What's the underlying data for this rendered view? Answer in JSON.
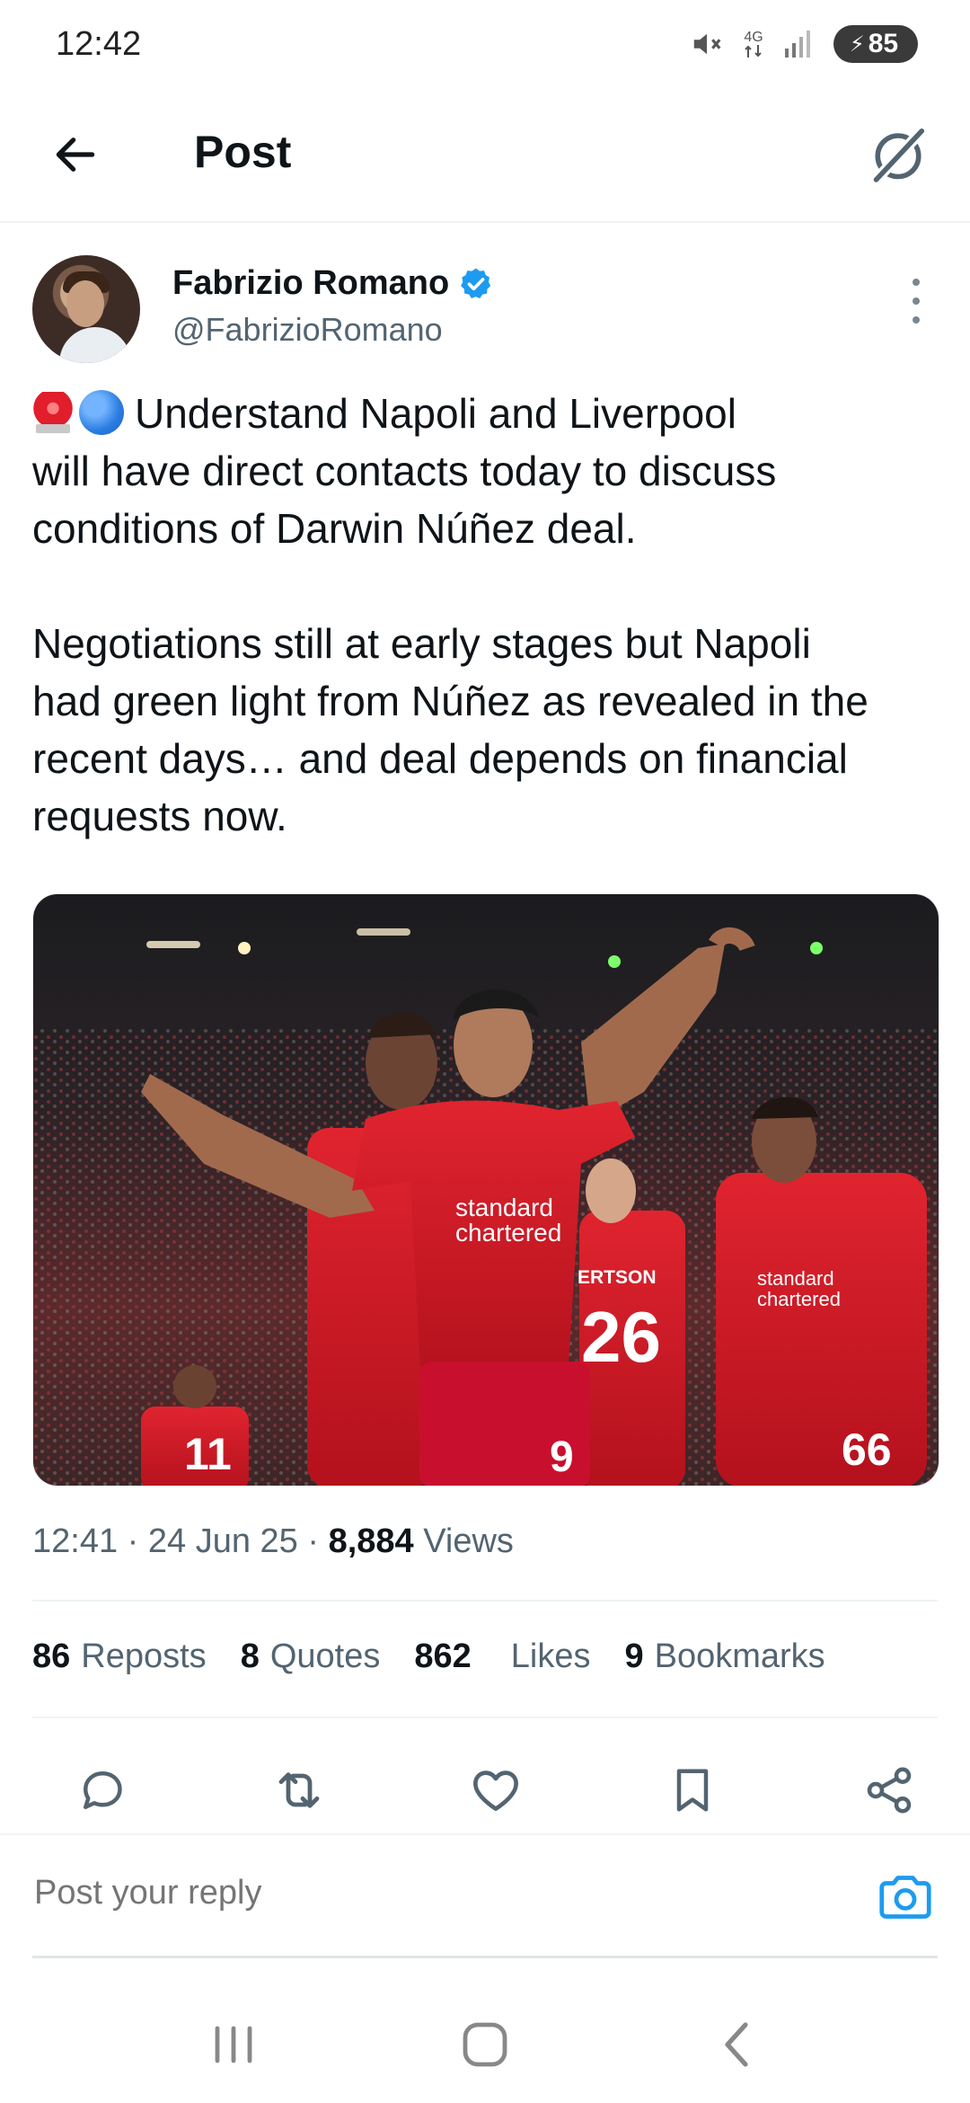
{
  "status_bar": {
    "time": "12:42",
    "network": "4G",
    "battery": "85"
  },
  "header": {
    "title": "Post",
    "back_icon": "arrow-left-icon",
    "grok_icon": "grok-icon"
  },
  "tweet": {
    "author": {
      "name": "Fabrizio Romano",
      "handle": "@FabrizioRomano",
      "verified": true
    },
    "text_line1": "Understand Napoli and Liverpool",
    "text_rest": "will have direct contacts today to discuss\nconditions of Darwin Núñez deal.\n\nNegotiations still at early stages but Napoli\nhad green light from Núñez as revealed in the\nrecent days… and deal depends on financial\nrequests now.",
    "emojis": [
      "rotating-light-emoji",
      "blue-circle-emoji"
    ],
    "media_label": "ERTSON",
    "meta": {
      "time": "12:41",
      "date": "24 Jun 25",
      "views_count": "8,884",
      "views_label": "Views"
    },
    "stats": {
      "reposts_count": "86",
      "reposts_label": "Reposts",
      "quotes_count": "8",
      "quotes_label": "Quotes",
      "likes_count": "862",
      "likes_label": "Likes",
      "bookmarks_count": "9",
      "bookmarks_label": "Bookmarks"
    }
  },
  "actions": [
    "reply-icon",
    "repost-icon",
    "like-icon",
    "bookmark-icon",
    "share-icon"
  ],
  "reply": {
    "placeholder": "Post your reply"
  },
  "colors": {
    "accent": "#1d9bf0",
    "text": "#0f1419",
    "secondary": "#536471",
    "divider": "#eff3f4",
    "liverpool_red": "#c8102e"
  }
}
